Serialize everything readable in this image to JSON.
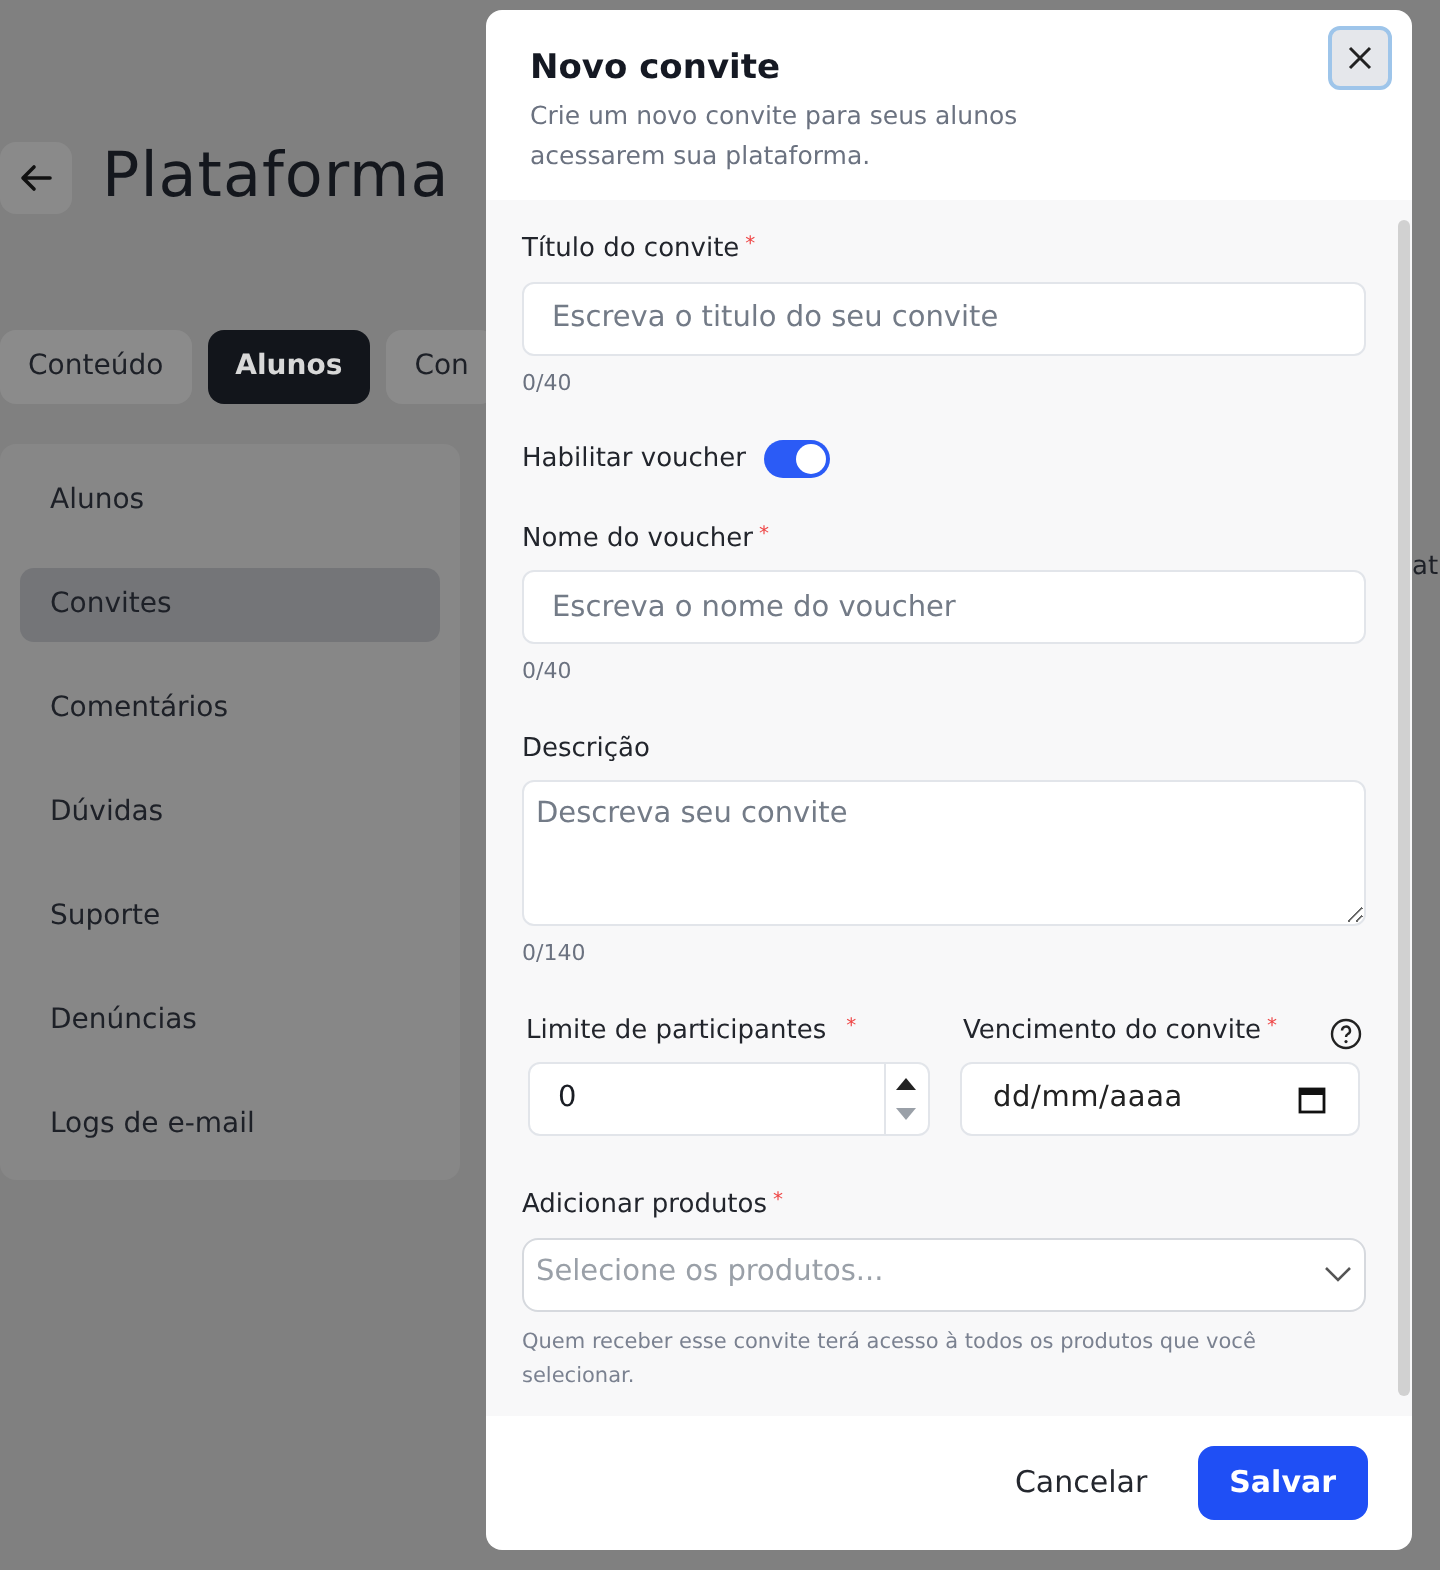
{
  "page": {
    "title": "Plataforma",
    "tabs": [
      {
        "label": "Conteúdo",
        "selected": false
      },
      {
        "label": "Alunos",
        "selected": true
      },
      {
        "label": "Con",
        "selected": false
      }
    ],
    "sidebar": {
      "items": [
        {
          "label": "Alunos",
          "selected": false
        },
        {
          "label": "Convites",
          "selected": true
        },
        {
          "label": "Comentários",
          "selected": false
        },
        {
          "label": "Dúvidas",
          "selected": false
        },
        {
          "label": "Suporte",
          "selected": false
        },
        {
          "label": "Denúncias",
          "selected": false
        },
        {
          "label": "Logs de e-mail",
          "selected": false
        }
      ]
    },
    "edge_texts": [
      "at"
    ]
  },
  "dialog": {
    "title": "Novo convite",
    "subtitle": "Crie um novo convite para seus alunos acessarem sua plataforma.",
    "fields": [
      {
        "kind": "text",
        "label": "Título do convite",
        "required_mark": "*",
        "placeholder": "Escreva o titulo do seu convite",
        "counter": "0/40"
      },
      {
        "kind": "toggle",
        "label": "Habilitar voucher",
        "on": true
      },
      {
        "kind": "text",
        "label": "Nome do voucher",
        "required_mark": "*",
        "placeholder": "Escreva o nome do voucher",
        "counter": "0/40"
      },
      {
        "kind": "textarea",
        "label": "Descrição",
        "placeholder": "Descreva seu convite",
        "counter": "0/140"
      },
      {
        "kind": "pair",
        "items": [
          {
            "kind": "number",
            "label": "Limite de participantes",
            "required_mark": "*",
            "value": "0"
          },
          {
            "kind": "date",
            "label": "Vencimento do convite",
            "required_mark": "*",
            "placeholder": "dd/mm/aaaa"
          }
        ]
      },
      {
        "kind": "select",
        "label": "Adicionar produtos",
        "required_mark": "*",
        "placeholder": "Selecione os produtos...",
        "hint": "Quem receber esse convite terá acesso à todos os produtos que você selecionar."
      }
    ],
    "buttons": [
      {
        "kind": "secondary",
        "label": "Cancelar"
      },
      {
        "kind": "primary",
        "label": "Salvar"
      }
    ]
  }
}
